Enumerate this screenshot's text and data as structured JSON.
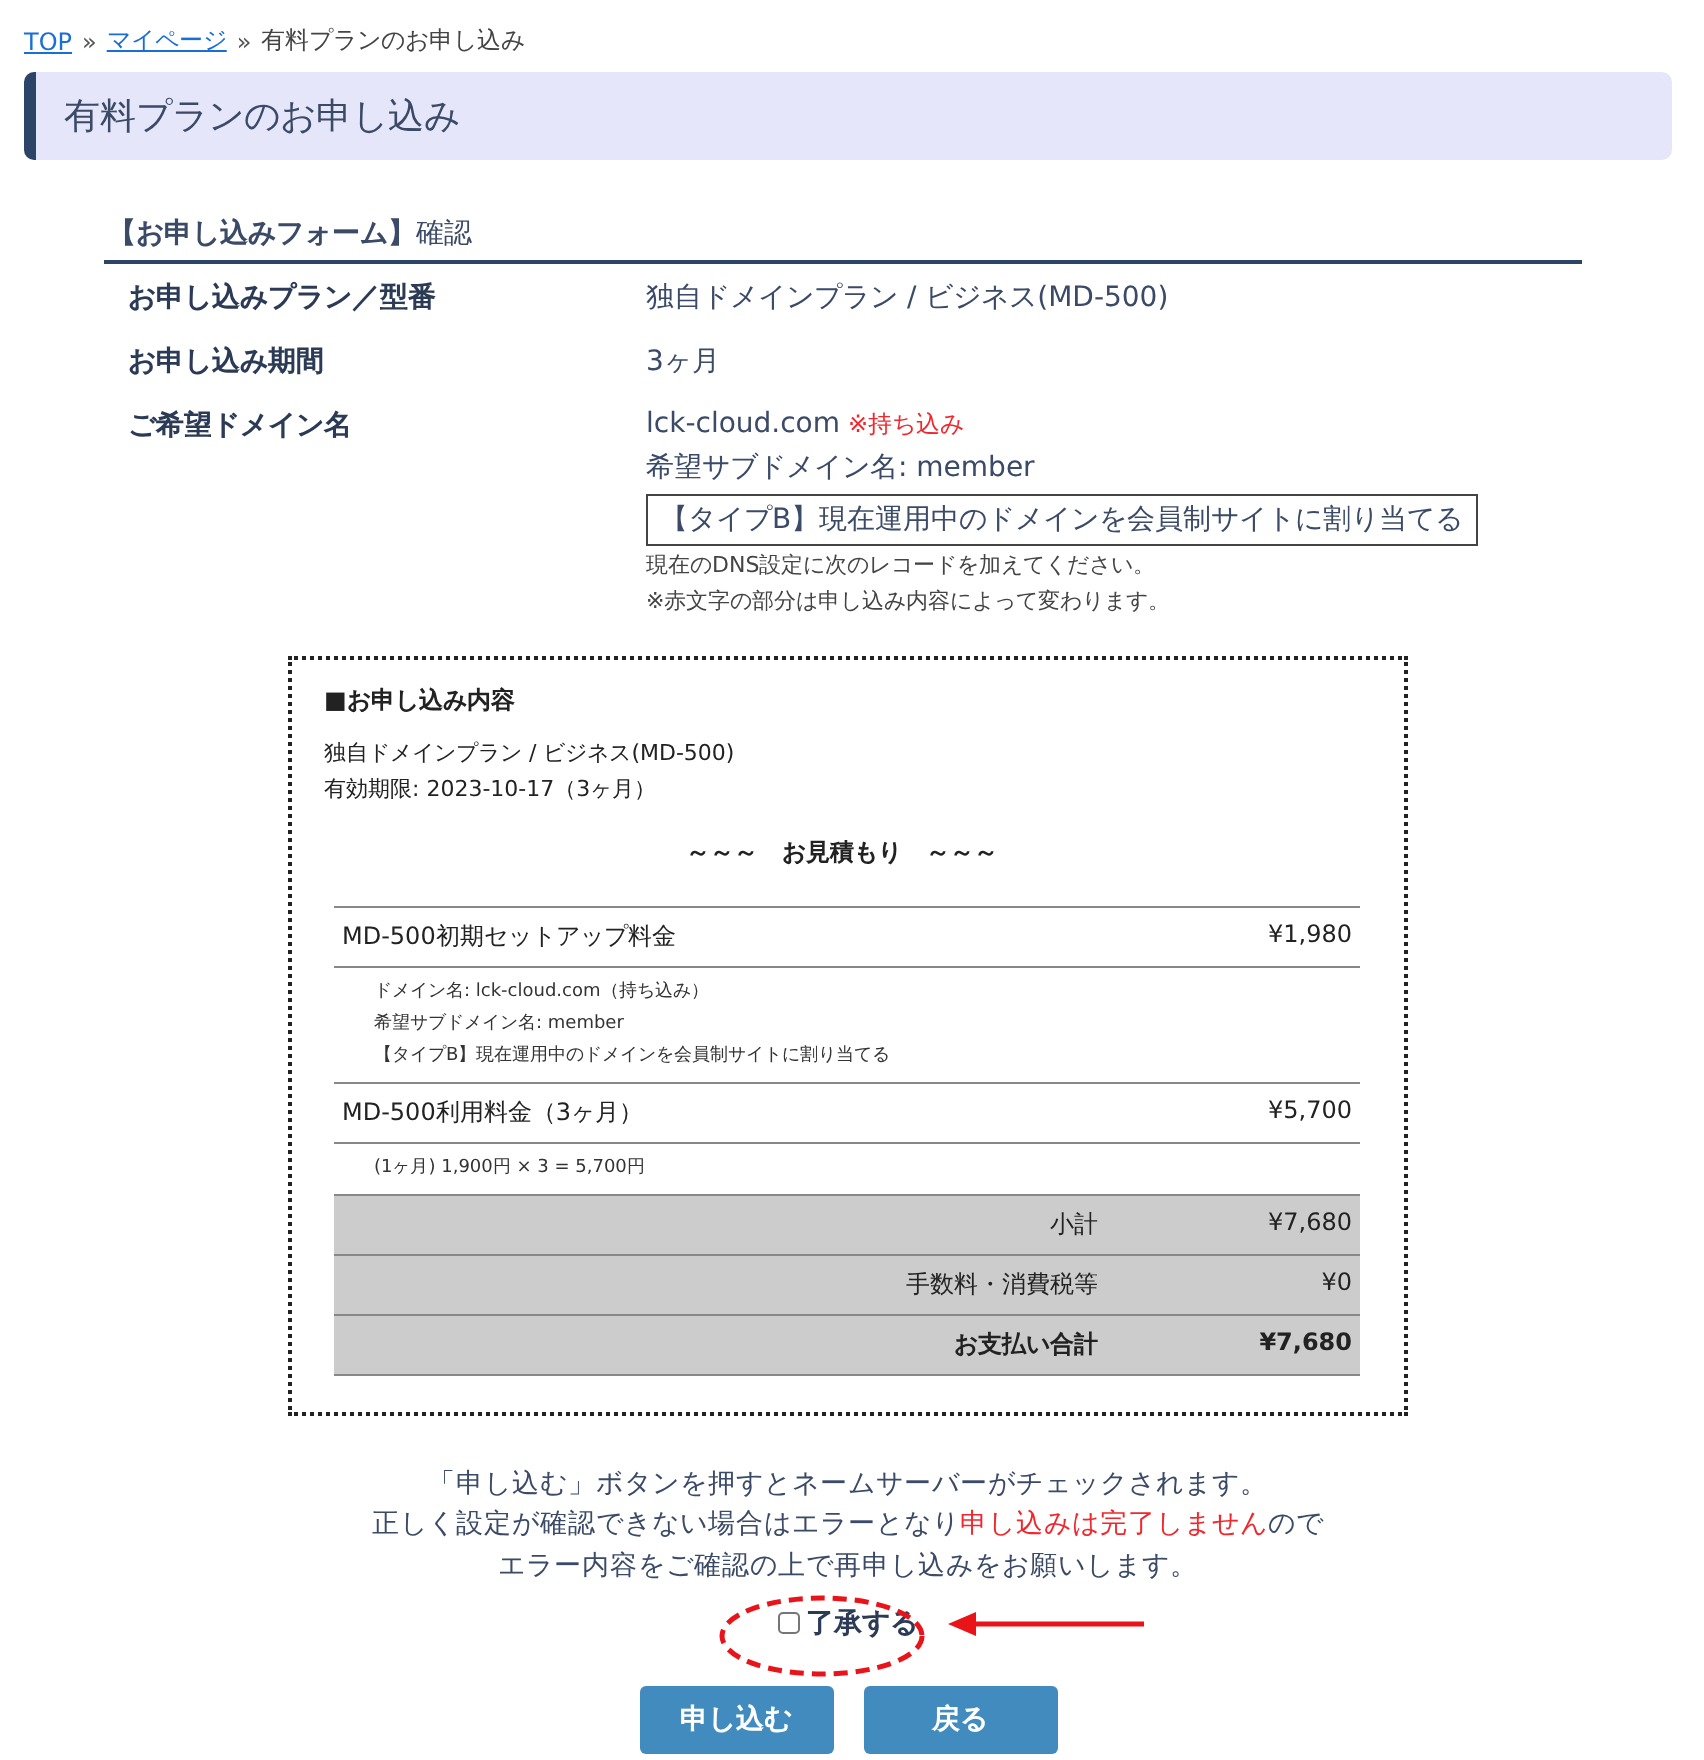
{
  "breadcrumb": [
    {
      "label": "TOP",
      "link": true
    },
    {
      "label": "マイページ",
      "link": true
    },
    {
      "label": "有料プランのお申し込み",
      "link": false
    }
  ],
  "breadcrumb_separator": "»",
  "page_title": "有料プランのお申し込み",
  "section": {
    "title_bold": "【お申し込みフォーム】",
    "title_rest": "確認"
  },
  "fields": [
    {
      "label": "お申し込みプラン／型番",
      "value": "独自ドメインプラン / ビジネス(MD-500)"
    },
    {
      "label": "お申し込み期間",
      "value": "3ヶ月"
    },
    {
      "label": "ご希望ドメイン名",
      "value": "lck-cloud.com",
      "value_note": "※持ち込み",
      "sub_value": "希望サブドメイン名: member",
      "type_box": "【タイプB】現在運用中のドメインを会員制サイトに割り当てる",
      "notes": [
        "現在のDNS設定に次のレコードを加えてください。",
        "※赤文字の部分は申し込み内容によって変わります。"
      ]
    }
  ],
  "summary": {
    "heading": "■お申し込み内容",
    "plan": "独自ドメインプラン / ビジネス(MD-500)",
    "expiry": "有効期限: 2023-10-17（3ヶ月）",
    "estimate_title": "～～～　お見積もり　～～～",
    "rows": [
      {
        "kind": "item",
        "label": "MD-500初期セットアップ料金",
        "amount": "¥1,980"
      },
      {
        "kind": "detail",
        "lines": [
          "ドメイン名: lck-cloud.com（持ち込み）",
          "希望サブドメイン名: member",
          "【タイプB】現在運用中のドメインを会員制サイトに割り当てる"
        ]
      },
      {
        "kind": "item",
        "label": "MD-500利用料金（3ヶ月）",
        "amount": "¥5,700"
      },
      {
        "kind": "detail",
        "lines": [
          "(1ヶ月) 1,900円 × 3 = 5,700円"
        ]
      },
      {
        "kind": "subtotal",
        "label": "小計",
        "amount": "¥7,680"
      },
      {
        "kind": "subtotal",
        "label": "手数料・消費税等",
        "amount": "¥0"
      },
      {
        "kind": "total",
        "label": "お支払い合計",
        "amount": "¥7,680"
      }
    ]
  },
  "notice": [
    [
      {
        "text": "「申し込む」ボタンを押すとネームサーバーがチェックされます。",
        "warning": false
      }
    ],
    [
      {
        "text": "正しく設定が確認できない場合はエラーとなり",
        "warning": false
      },
      {
        "text": "申し込みは完了しません",
        "warning": true
      },
      {
        "text": "ので",
        "warning": false
      }
    ],
    [
      {
        "text": "エラー内容をご確認の上で再申し込みをお願いします。",
        "warning": false
      }
    ]
  ],
  "consent": {
    "label": "了承する",
    "checked": false
  },
  "buttons": [
    "申し込む",
    "戻る"
  ]
}
